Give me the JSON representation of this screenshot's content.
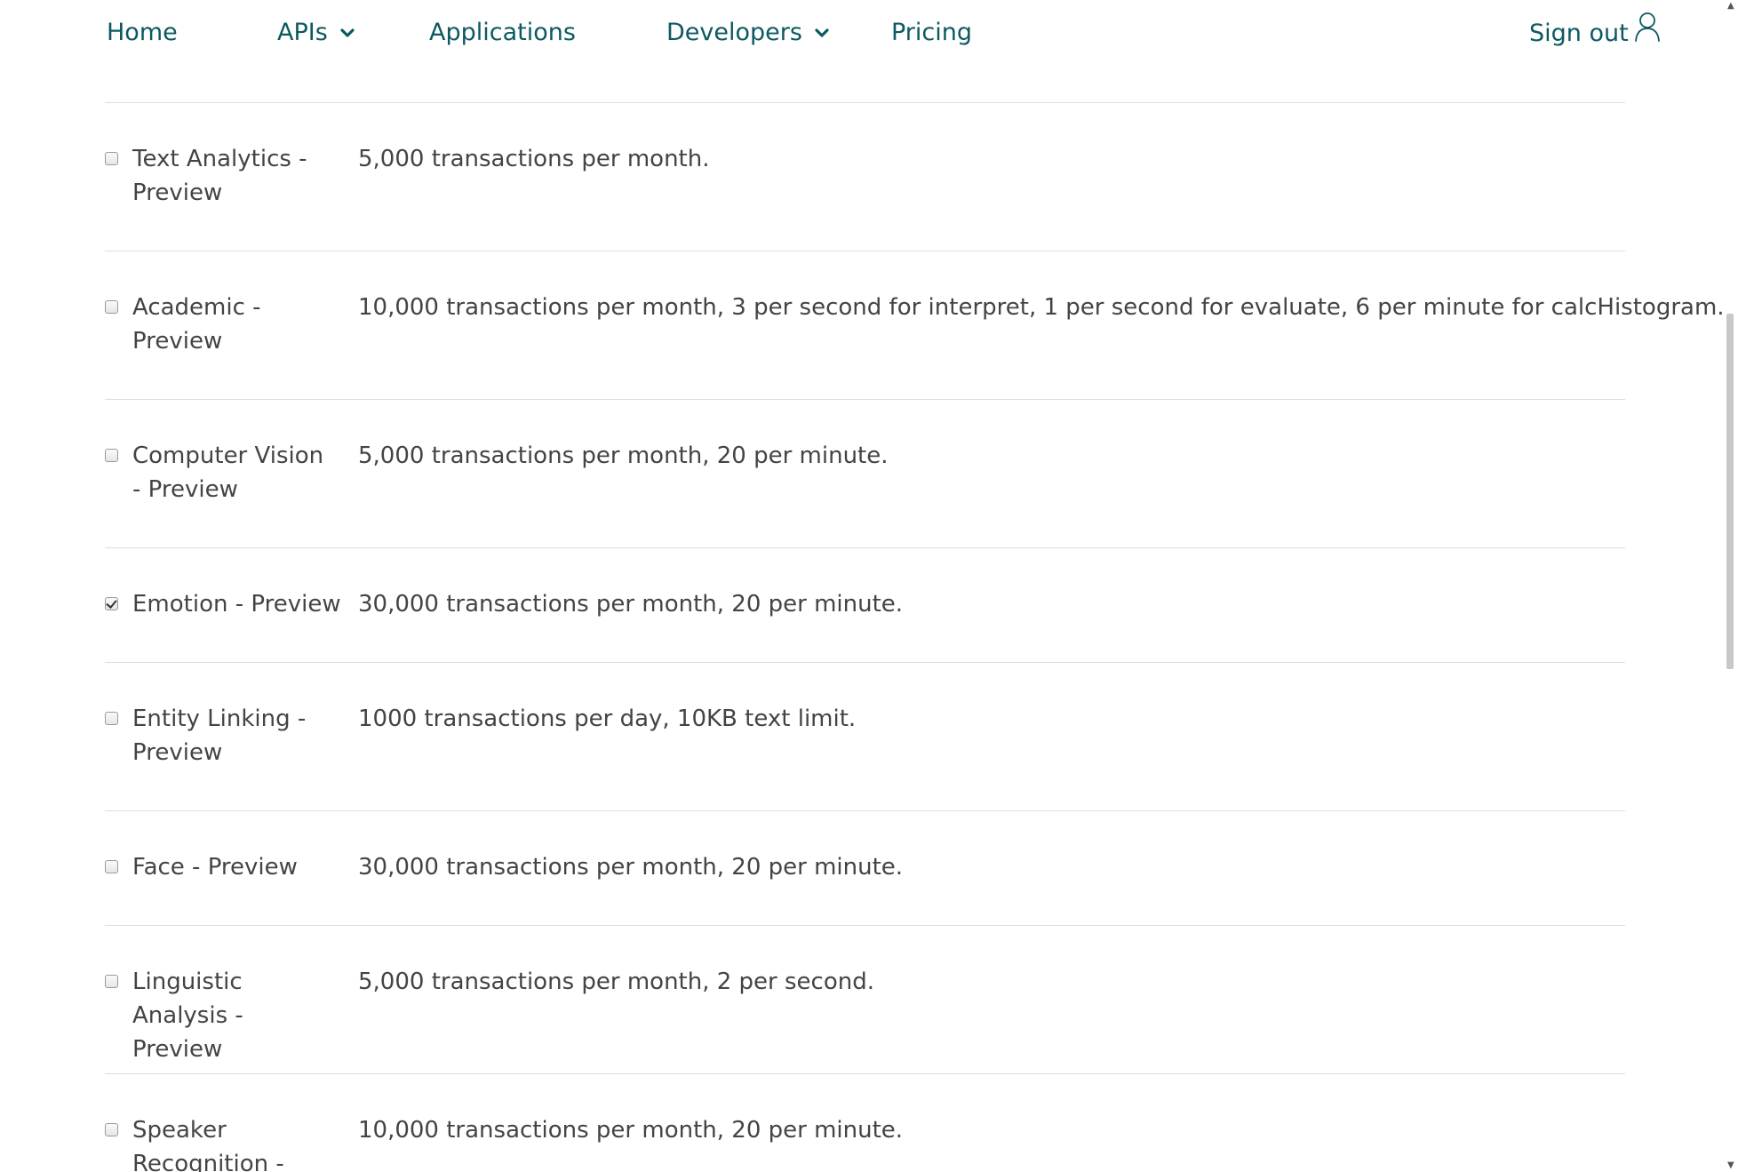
{
  "nav": {
    "home": "Home",
    "apis": "APIs",
    "applications": "Applications",
    "developers": "Developers",
    "pricing": "Pricing",
    "sign_out": "Sign out"
  },
  "plans": [
    {
      "name": "Text Analytics - Preview",
      "limit": "5,000 transactions per month.",
      "checked": false
    },
    {
      "name": "Academic - Preview",
      "limit": "10,000 transactions per month, 3 per second for interpret, 1 per second for evaluate, 6 per minute for calcHistogram.",
      "checked": false
    },
    {
      "name": "Computer Vision - Preview",
      "limit": "5,000 transactions per month, 20 per minute.",
      "checked": false
    },
    {
      "name": "Emotion - Preview",
      "limit": "30,000 transactions per month, 20 per minute.",
      "checked": true
    },
    {
      "name": "Entity Linking - Preview",
      "limit": "1000 transactions per day, 10KB text limit.",
      "checked": false
    },
    {
      "name": "Face - Preview",
      "limit": "30,000 transactions per month, 20 per minute.",
      "checked": false
    },
    {
      "name": "Linguistic Analysis - Preview",
      "limit": "5,000 transactions per month, 2 per second.",
      "checked": false
    },
    {
      "name": "Speaker Recognition -",
      "limit": "10,000 transactions per month, 20 per minute.",
      "checked": false
    }
  ],
  "colors": {
    "nav_text": "#0c5a60",
    "body_text": "#444444",
    "divider": "#dddddd"
  }
}
